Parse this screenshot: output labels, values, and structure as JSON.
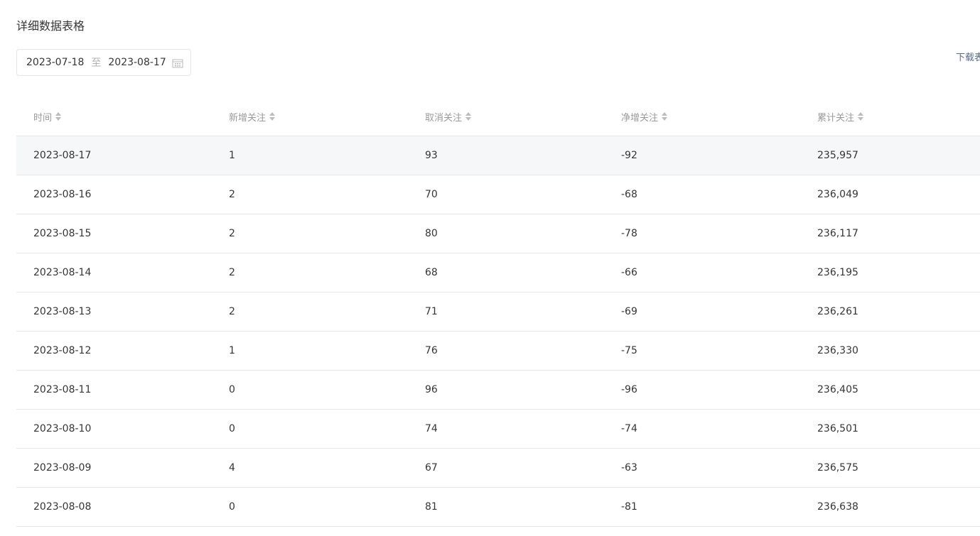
{
  "section": {
    "title": "详细数据表格"
  },
  "date_range": {
    "start": "2023-07-18",
    "separator": "至",
    "end": "2023-08-17"
  },
  "download_label": "下载表",
  "table": {
    "columns": [
      "时间",
      "新增关注",
      "取消关注",
      "净增关注",
      "累计关注"
    ],
    "rows": [
      [
        "2023-08-17",
        "1",
        "93",
        "-92",
        "235,957"
      ],
      [
        "2023-08-16",
        "2",
        "70",
        "-68",
        "236,049"
      ],
      [
        "2023-08-15",
        "2",
        "80",
        "-78",
        "236,117"
      ],
      [
        "2023-08-14",
        "2",
        "68",
        "-66",
        "236,195"
      ],
      [
        "2023-08-13",
        "2",
        "71",
        "-69",
        "236,261"
      ],
      [
        "2023-08-12",
        "1",
        "76",
        "-75",
        "236,330"
      ],
      [
        "2023-08-11",
        "0",
        "96",
        "-96",
        "236,405"
      ],
      [
        "2023-08-10",
        "0",
        "74",
        "-74",
        "236,501"
      ],
      [
        "2023-08-09",
        "4",
        "67",
        "-63",
        "236,575"
      ],
      [
        "2023-08-08",
        "0",
        "81",
        "-81",
        "236,638"
      ]
    ]
  },
  "colors": {
    "link": "#576b95",
    "row_highlight": "#f6f7f8",
    "border": "#e7e7eb"
  },
  "icons": {
    "calendar": "calendar-icon",
    "sort": "sort-icon"
  }
}
